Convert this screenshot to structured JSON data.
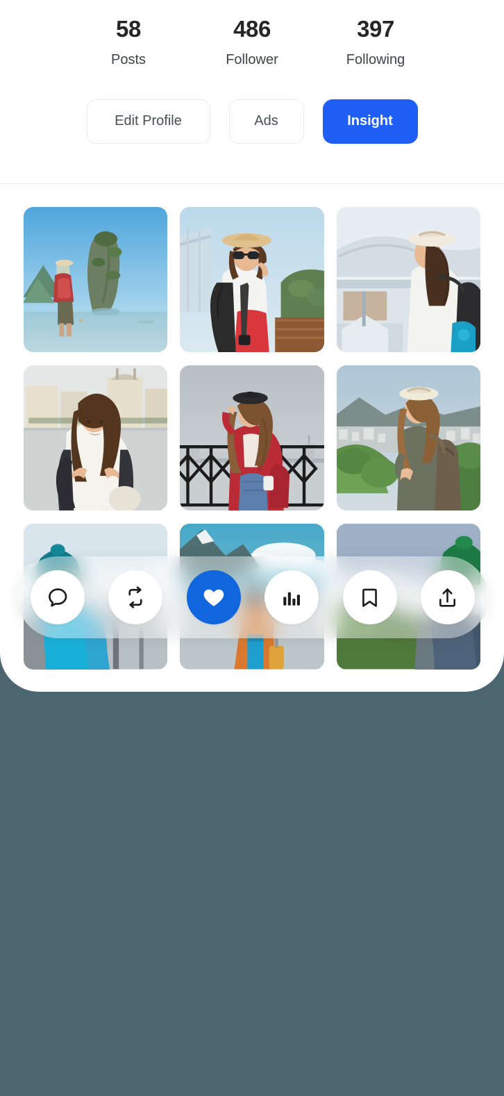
{
  "theme": {
    "page_background": "#4c6670",
    "card_background": "#ffffff",
    "primary_accent": "#1f5ff5",
    "active_icon_background": "#1266dd",
    "divider": "#ececec",
    "text_primary": "#262626",
    "text_secondary": "#3f4349"
  },
  "profile": {
    "stats": [
      {
        "value": "58",
        "label": "Posts"
      },
      {
        "value": "486",
        "label": "Follower"
      },
      {
        "value": "397",
        "label": "Following"
      }
    ],
    "actions": [
      {
        "label": "Edit Profile",
        "style": "outline"
      },
      {
        "label": "Ads",
        "style": "outline"
      },
      {
        "label": "Insight",
        "style": "primary"
      }
    ]
  },
  "gallery": {
    "tiles": [
      {
        "id": "tile-1",
        "alt": "Traveler with red backpack at limestone island"
      },
      {
        "id": "tile-2",
        "alt": "Woman in straw hat and sunglasses with camera"
      },
      {
        "id": "tile-3",
        "alt": "Woman in white hat looking out over harbour"
      },
      {
        "id": "tile-4",
        "alt": "Smiling woman with backpack in front of city"
      },
      {
        "id": "tile-5",
        "alt": "Woman in red jacket by iron railing"
      },
      {
        "id": "tile-6",
        "alt": "Woman with backpack overlooking green hillside town"
      },
      {
        "id": "tile-7",
        "alt": "Person in teal beanie by the coast"
      },
      {
        "id": "tile-8",
        "alt": "Traveler with suitcase under cloudy mountain sky"
      },
      {
        "id": "tile-9",
        "alt": "Person in green beanie in mountain landscape"
      }
    ]
  },
  "action_bar": {
    "buttons": [
      {
        "icon": "comment-icon",
        "name": "comment-button",
        "active": false
      },
      {
        "icon": "repost-icon",
        "name": "repost-button",
        "active": false
      },
      {
        "icon": "heart-icon",
        "name": "like-button",
        "active": true
      },
      {
        "icon": "analytics-icon",
        "name": "analytics-button",
        "active": false
      },
      {
        "icon": "bookmark-icon",
        "name": "bookmark-button",
        "active": false
      },
      {
        "icon": "share-icon",
        "name": "share-button",
        "active": false
      }
    ]
  }
}
